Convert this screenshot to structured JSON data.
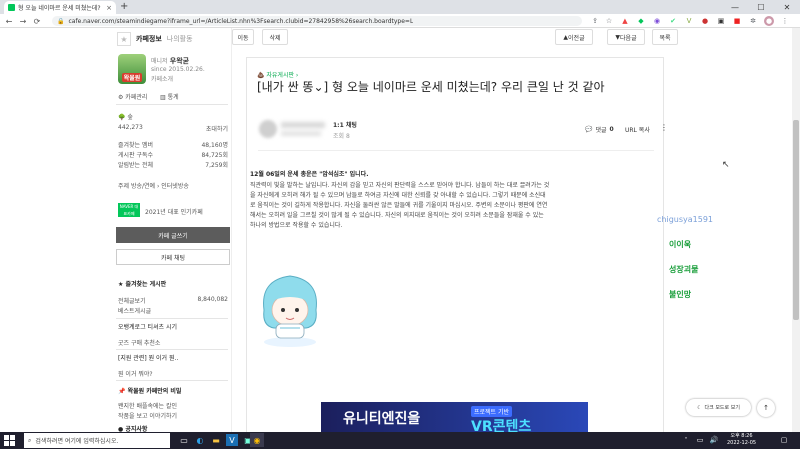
{
  "browser": {
    "tab_title": "형 오늘 네이마르 운세 미쳤는데?",
    "tab_close": "×",
    "new_tab": "+",
    "url": "cafe.naver.com/steamindiegame?iframe_url=/ArticleList.nhn%3Fsearch.clubid=27842958%26search.boardtype=L",
    "back": "←",
    "forward": "→",
    "reload": "⟳",
    "minimize": "—",
    "maximize": "☐",
    "close": "✕"
  },
  "sidebar": {
    "tab_cafe_info": "카페정보",
    "tab_my_activity": "나의활동",
    "manager_label": "매니저",
    "manager_name": "우왁굳",
    "since": "since 2015.02.26.",
    "cafe_intro": "카페소개",
    "cafe_name_badge": "왁물원",
    "cafe_manage": "카페관리",
    "stats": "통계",
    "level": "숲",
    "members": "442,273",
    "invite": "초대하기",
    "fav_member_label": "즐겨찾는 멤버",
    "fav_member_value": "48,160명",
    "board_sub_label": "게시판 구독수",
    "board_sub_value": "84,725회",
    "notify_label": "알림받는 전체",
    "notify_value": "7,259회",
    "tags": "주제 방송/연예 › 인터넷방송",
    "naver_badge": "NAVER 대표카페",
    "naver_rank": "2021년 대표 인기카페",
    "write_btn": "카페 글쓰기",
    "chat_btn": "카페 채팅",
    "fav_boards_title": "즐겨찾는 게시판",
    "all_posts": "전체글보기",
    "all_posts_count": "8,840,082",
    "best_posts": "베스트게시글",
    "section1": "오뱅계로그 티셔츠 시기",
    "item1": "굿즈 구매 추천소",
    "section2": "[지원 관련] 뭔 이거 뭔..",
    "item2": "뭔 이거 뭐야?",
    "section3": "왁물원 카페만의 비밀",
    "item3a": "왠지한 배플속에는 칼인",
    "item3b": "작품을 보고 이야기하기",
    "section4": "공지사항"
  },
  "article": {
    "top_list": "이동",
    "top_delete": "삭제",
    "prev": "이전글",
    "next": "다음글",
    "list": "목록",
    "board": "자유게시판 ›",
    "title": "[내가 싼 똥⌄] 형 오늘 네이마르 운세 미쳤는데? 우리 큰일 난 것 같아",
    "author_rank": "1:1 채팅",
    "views": "조회 8",
    "comments_label": "댓글",
    "comments_count": "0",
    "url_copy": "URL 복사",
    "more": "⋮",
    "body_head": "12월 06일의 운세 총운은 \"암석심조\" 입니다.",
    "body_text": "직관력이 빛을 발하는 날입니다. 자신의 감을 믿고 자신의 판단력을 스스로 믿어야 합니다. 남들이 하는 대로 끌려가는 것을 자신에게 오히려 해가 될 수 있으며 남들로 하여금 자신에 대한 신뢰를 갖 아내할 수 있습니다. 그렇기 때문에 소신대로 움직이는 것이 길하게 작용합니다. 자신을 둘러싼 않은 말들에 귀를 기울이지 마십시오. 주변의 소문이나 평판에 연연해서는 오히려 일을 그르칠 것이 많게 될 수 있습니다. 자신의 의지대로 움직이는 것이 오히려 소문들을 잠재울 수 있는 하나의 방법으로 작용할 수 있습니다.",
    "ad_text": "유니티엔진을",
    "ad_tag": "프로젝트 기반",
    "ad_big": "VR콘텐츠"
  },
  "chat_overlay": {
    "name": "chigusya1591",
    "line1": "이이욱",
    "line2": "성장괴물",
    "line3": "불인망"
  },
  "widgets": {
    "dark_mode": "다크 모드로 보기",
    "top": "↑"
  },
  "taskbar": {
    "search_placeholder": "검색하려면 여기에 입력하십시오.",
    "time": "오후 8:26",
    "date": "2022-12-05"
  },
  "colors": {
    "naver_green": "#03c75a",
    "overlay_name": "#7a9fd8",
    "overlay_line1": "#1a9e3b",
    "overlay_line2": "#1a9e3b",
    "overlay_line3": "#1a9e3b"
  }
}
